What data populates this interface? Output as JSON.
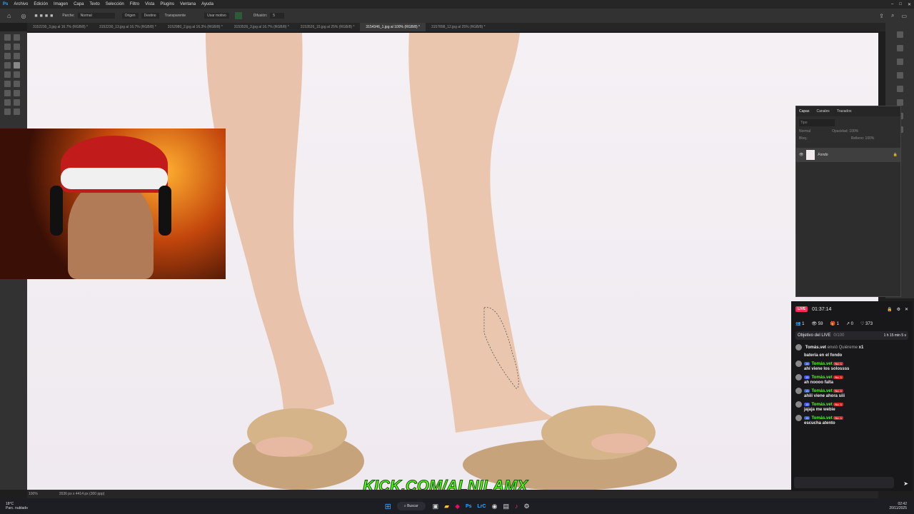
{
  "menubar": {
    "app_icon": "Ps",
    "items": [
      "Archivo",
      "Edición",
      "Imagen",
      "Capa",
      "Texto",
      "Selección",
      "Filtro",
      "Vista",
      "Plugins",
      "Ventana",
      "Ayuda"
    ]
  },
  "options": {
    "parche_label": "Parche:",
    "parche_value": "Normal",
    "origen": "Origen",
    "destino": "Destino",
    "transparente": "Transparente",
    "usar_motivo": "Usar motivo",
    "difusion_label": "Difusión:",
    "difusion_value": "5"
  },
  "tabs": [
    "3152230_3.jpg al 16.7% (RGB/8) *",
    "3152230_13.jpg al 16.7% (RGB/8) *",
    "3152980_2.jpg al 16.3% (RGB/8) *",
    "3153526_3.jpg al 16.7% (RGB/8) *",
    "3153526_15.jpg al 25% (RGB/8) *",
    "3154346_1.jpg al 100% (RGB/8) *",
    "3157898_12.jpg al 25% (RGB/8) *"
  ],
  "active_tab": 5,
  "layers_panel": {
    "tabs": [
      "Capas",
      "Canales",
      "Trazados"
    ],
    "search_placeholder": "Tipo",
    "blend": "Normal",
    "opacity_label": "Opacidad:",
    "opacity_value": "100%",
    "lock_label": "Bloq.:",
    "fill_label": "Relleno:",
    "fill_value": "100%",
    "layer_name": "Fondo"
  },
  "status": {
    "zoom": "100%",
    "doc_info": "3536 px x 4414 px (300 ppp)"
  },
  "watermark": "KICK.COM/ALNILAMX",
  "chat": {
    "live": "LIVE",
    "timer": "01:37:14",
    "stats": {
      "users": "1",
      "viewers": "59",
      "gifts": "1",
      "shares": "0",
      "likes": "373"
    },
    "goal_label": "Objetivo del LIVE",
    "goal_count": "0/100",
    "goal_time": "1 h 15 min 5 s",
    "gift_user": "Tomás.vet",
    "gift_text": "envió Quiéreme",
    "gift_count": "x1",
    "first_msg": "batería en el fondo",
    "badge_level": "15",
    "badge_no": "No. 1",
    "messages": [
      {
        "user": "Tomás.vet",
        "text": "ahí viene los solossss"
      },
      {
        "user": "Tomás.vet",
        "text": "ah noooo falta"
      },
      {
        "user": "Tomás.vet",
        "text": "ahiii viene ahora siii"
      },
      {
        "user": "Tomás.vet",
        "text": "jajaja me webie"
      },
      {
        "user": "Tomás.vet",
        "text": "escucha atento"
      }
    ]
  },
  "taskbar": {
    "weather_temp": "18°C",
    "weather_desc": "Parc. nublado",
    "search": "Buscar",
    "time": "02:42",
    "date": "20/11/2025"
  },
  "colors": {
    "kick_green": "#53fc18",
    "live_pink": "#fe2c55"
  }
}
